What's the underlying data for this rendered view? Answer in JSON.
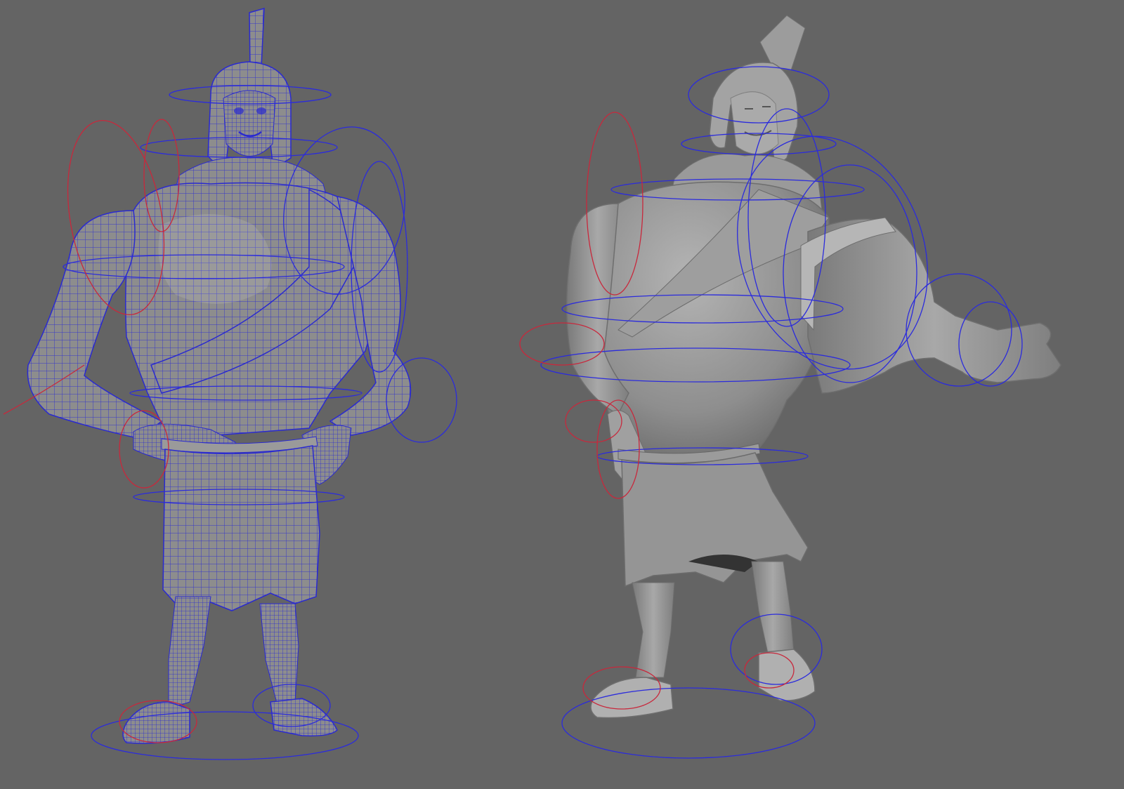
{
  "viewport": {
    "background": "#646464",
    "panes": [
      {
        "display_mode": "wireframe-on-shaded",
        "pose": "hands-on-hips"
      },
      {
        "display_mode": "smooth-shaded",
        "pose": "arm-extended"
      }
    ]
  },
  "colors": {
    "mesh_fill": "#8e8e8e",
    "mesh_shadow": "#6f6f6f",
    "wire": "#2a2ad0",
    "control_blue": "#2b2bdc",
    "control_red": "#c8283c"
  },
  "icons": {
    "wire_character": "spartan-wireframe-rig",
    "shaded_character": "spartan-shaded-rig"
  }
}
